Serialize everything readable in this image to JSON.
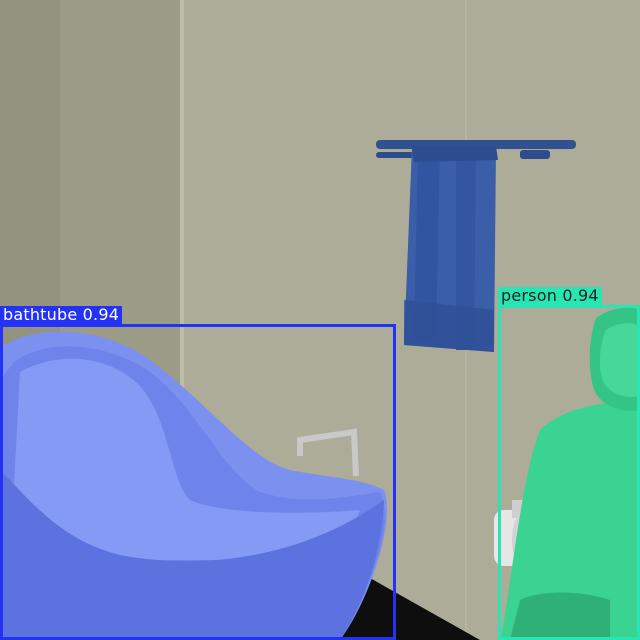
{
  "detections": [
    {
      "label": "bathtube 0.94",
      "color": "#2332f5",
      "text_color": "#ffffff"
    },
    {
      "label": "person 0.94",
      "color": "#27e6b4",
      "text_color": "#222222"
    }
  ]
}
